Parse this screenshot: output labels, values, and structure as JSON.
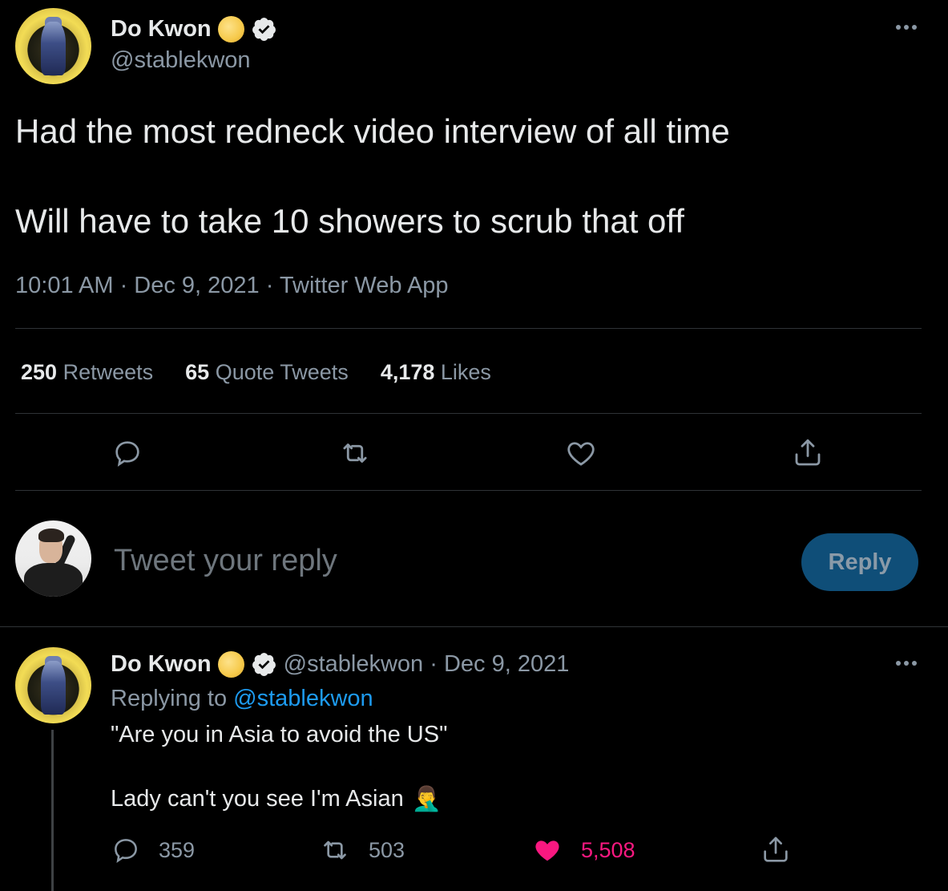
{
  "tweet": {
    "author_name": "Do Kwon",
    "author_handle": "@stablekwon",
    "text_line1": "Had the most redneck video interview of all time",
    "text_line2": "Will have to take 10 showers to scrub that off",
    "meta": "10:01 AM · Dec 9, 2021 · Twitter Web App",
    "stats": {
      "retweets_count": "250",
      "retweets_label": "Retweets",
      "quotes_count": "65",
      "quotes_label": "Quote Tweets",
      "likes_count": "4,178",
      "likes_label": "Likes"
    }
  },
  "compose": {
    "placeholder": "Tweet your reply",
    "reply_button": "Reply"
  },
  "reply": {
    "author_name": "Do Kwon",
    "handle_date": "@stablekwon · Dec 9, 2021",
    "replying_to_label": "Replying to",
    "replying_to_handle": "@stablekwon",
    "text_line1": "\"Are you in Asia to avoid the US\"",
    "text_line2": "Lady can't you see I'm Asian",
    "emoji": "🤦‍♂️",
    "replies": "359",
    "retweets": "503",
    "likes": "5,508"
  },
  "colors": {
    "background": "#000000",
    "text": "#e7e9ea",
    "muted": "#8b98a5",
    "link": "#1d9bf0",
    "reply_button_bg": "#0f4e78",
    "like_pink": "#f91880",
    "divider": "#2f3336"
  },
  "icons": [
    "more-icon",
    "coin-icon",
    "verified-icon",
    "reply-icon",
    "retweet-icon",
    "like-icon",
    "share-icon",
    "facepalm-emoji"
  ]
}
